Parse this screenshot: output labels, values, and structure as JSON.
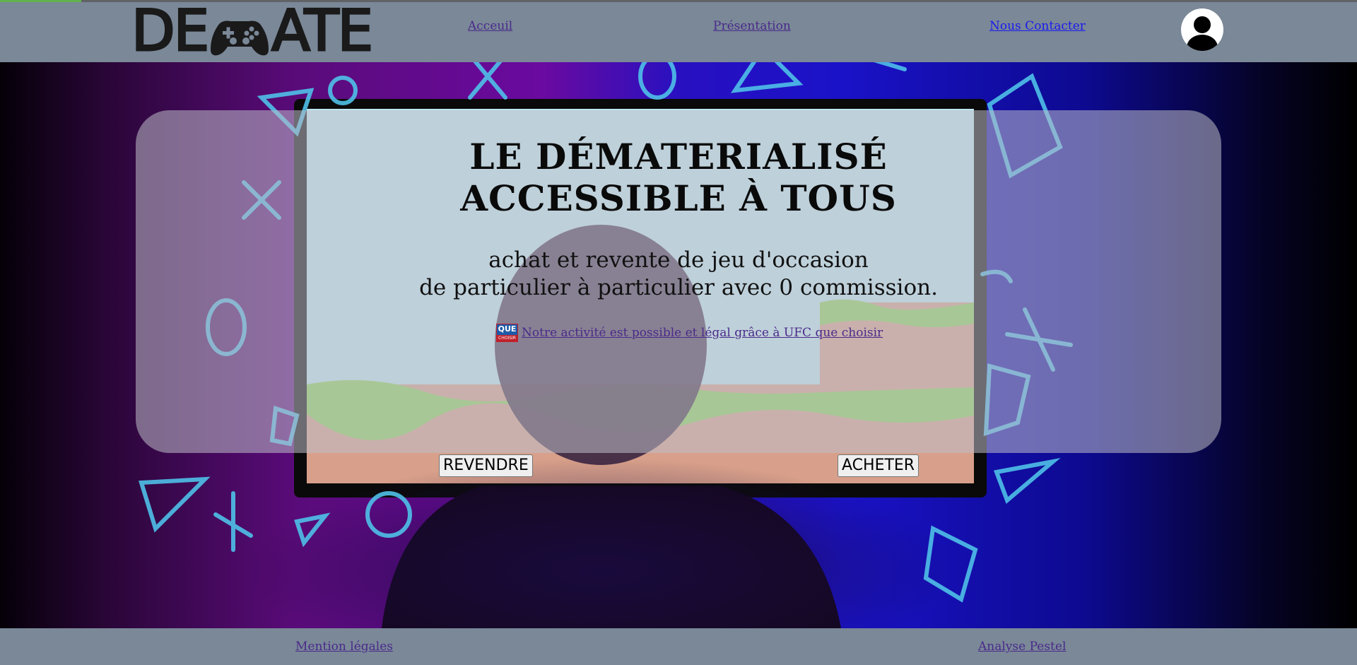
{
  "header": {
    "logo": {
      "left": "DE",
      "right": "ATE",
      "icon": "gamepad-icon"
    },
    "nav": [
      {
        "label": "Acceuil"
      },
      {
        "label": "Présentation"
      },
      {
        "label": "Nous Contacter"
      }
    ],
    "avatar_icon": "user-avatar-icon"
  },
  "hero": {
    "title_line1": "LE DÉMATERIALISÉ",
    "title_line2": "ACCESSIBLE À TOUS",
    "subtitle_line1": "achat et revente de jeu d'occasion",
    "subtitle_line2": "de particulier à particulier avec 0 commission.",
    "ufc_badge_top": "QUE",
    "ufc_badge_bottom": "CHOISIR",
    "ufc_link": "Notre activité est possible et légal grâce à UFC que choisir"
  },
  "buttons": {
    "sell": "REVENDRE",
    "buy": "ACHETER"
  },
  "footer": {
    "legal": "Mention légales",
    "pestel": "Analyse Pestel"
  },
  "colors": {
    "header_bg": "#7a8898",
    "visited_link": "#4a2a8a",
    "link": "#1a1aee"
  }
}
